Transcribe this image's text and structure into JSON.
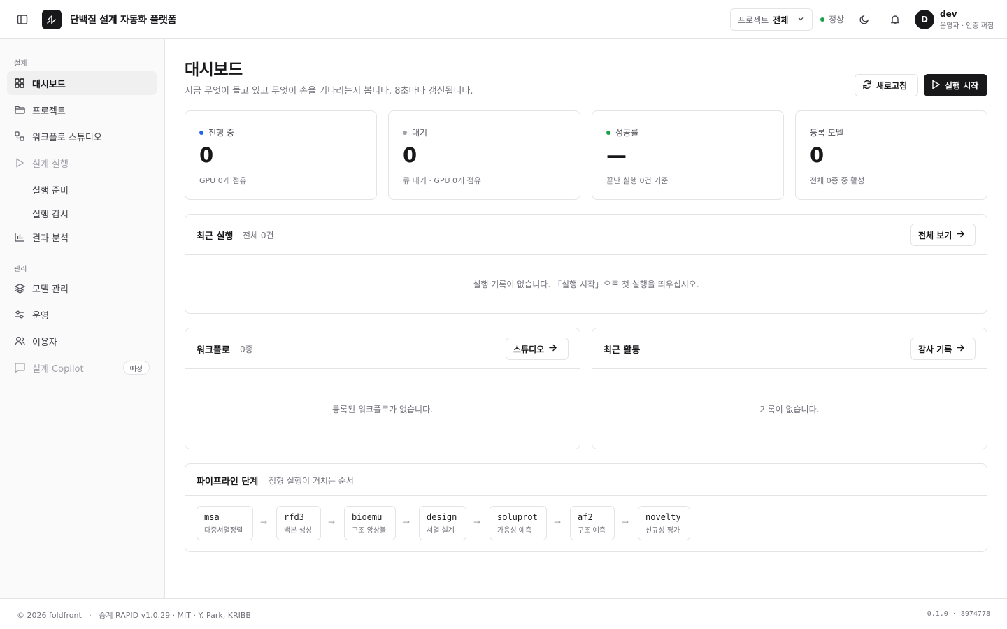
{
  "header": {
    "app_title": "단백질 설계 자동화 플랫폼",
    "project_label": "프로젝트",
    "project_value": "전체",
    "status_text": "정상",
    "status_color": "#16a34a",
    "user_initial": "D",
    "user_name": "dev",
    "user_role": "운영자 · 인증 꺼짐"
  },
  "sidebar": {
    "section_design": "설계",
    "section_admin": "관리",
    "items": {
      "dashboard": "대시보드",
      "projects": "프로젝트",
      "workflow_studio": "워크플로 스튜디오",
      "design_run": "설계 실행",
      "run_prep": "실행 준비",
      "run_monitor": "실행 감시",
      "results": "결과 분석",
      "models": "모델 관리",
      "ops": "운영",
      "users": "이용자",
      "copilot": "설계 Copilot",
      "copilot_badge": "예정"
    }
  },
  "main": {
    "title": "대시보드",
    "subtitle": "지금 무엇이 돌고 있고 무엇이 손을 기다리는지 봅니다. 8초마다 갱신됩니다.",
    "refresh_label": "새로고침",
    "start_label": "실행 시작",
    "stats": [
      {
        "label": "진행 중",
        "value": "0",
        "foot": "GPU 0개 점유",
        "dot_color": "#2563eb"
      },
      {
        "label": "대기",
        "value": "0",
        "foot": "큐 대기 · GPU 0개 점유",
        "dot_color": "#a1a1aa"
      },
      {
        "label": "성공률",
        "value": "—",
        "foot": "끝난 실행 0건 기준",
        "dot_color": "#16a34a"
      },
      {
        "label": "등록 모델",
        "value": "0",
        "foot": "전체 0종 중 활성"
      }
    ],
    "recent_runs": {
      "title": "최근 실행",
      "count": "전체 0건",
      "view_all": "전체 보기",
      "empty": "실행 기록이 없습니다. 「실행 시작」으로 첫 실행을 띄우십시오."
    },
    "workflows": {
      "title": "워크플로",
      "count": "0종",
      "button": "스튜디오",
      "empty": "등록된 워크플로가 없습니다."
    },
    "activity": {
      "title": "최근 활동",
      "button": "감사 기록",
      "empty": "기록이 없습니다."
    },
    "pipeline": {
      "title": "파이프라인 단계",
      "subtitle": "정형 실행이 거치는 순서",
      "steps": [
        {
          "code": "msa",
          "desc": "다중서열정렬"
        },
        {
          "code": "rfd3",
          "desc": "백본 생성"
        },
        {
          "code": "bioemu",
          "desc": "구조 앙상블"
        },
        {
          "code": "design",
          "desc": "서열 설계"
        },
        {
          "code": "soluprot",
          "desc": "가용성 예측"
        },
        {
          "code": "af2",
          "desc": "구조 예측"
        },
        {
          "code": "novelty",
          "desc": "신규성 평가"
        }
      ]
    }
  },
  "footer": {
    "left": "© 2026 foldfront   ·   승계 RAPID v1.0.29 · MIT · Y. Park, KRIBB",
    "right": "0.1.0 · 8974778"
  }
}
